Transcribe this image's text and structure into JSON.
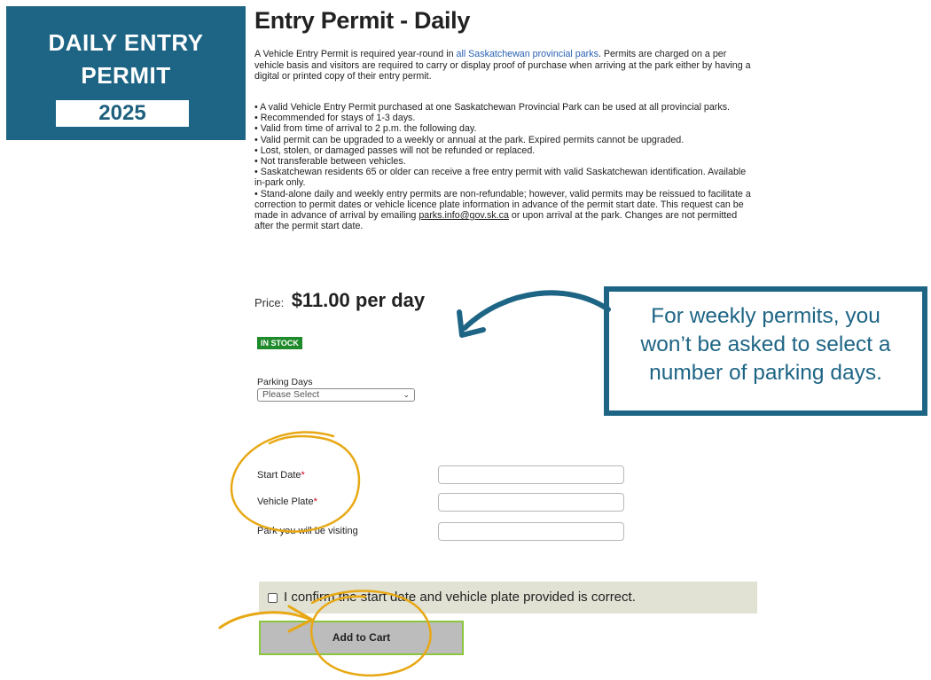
{
  "badge": {
    "line1": "DAILY ENTRY",
    "line2": "PERMIT",
    "year": "2025"
  },
  "page": {
    "title": "Entry Permit - Daily",
    "intro_before_link": "A Vehicle Entry Permit is required year-round in ",
    "intro_link": "all Saskatchewan provincial parks",
    "intro_after_link": ". Permits are charged on a per vehicle basis and visitors are required to carry or display proof of purchase when arriving at the park either by having a digital or printed copy of their entry permit."
  },
  "bullets": [
    "•  A valid Vehicle Entry Permit purchased at one Saskatchewan Provincial Park can be used at all provincial parks.",
    "•  Recommended for stays of 1-3 days.",
    "•  Valid from time of arrival to 2 p.m. the following day.",
    "•  Valid permit can be upgraded to a weekly or annual at the park. Expired permits cannot be upgraded.",
    "•  Lost, stolen, or damaged passes will not be refunded or replaced.",
    "•  Not transferable between vehicles.",
    "•  Saskatchewan residents 65 or older can receive a free entry permit with valid Saskatchewan identification. Available in-park only."
  ],
  "last_bullet": {
    "before_link": "•  Stand-alone daily and weekly entry permits are non-refundable; however, valid permits may be reissued to facilitate a correction to permit dates or vehicle licence plate information in advance of the permit start date. This request can be made in advance of arrival by emailing ",
    "link": "parks.info@gov.sk.ca",
    "after_link": " or upon arrival at the park. Changes are not permitted after the permit start date."
  },
  "price": {
    "label": "Price:",
    "value": "$11.00 per day"
  },
  "stock_badge": "IN STOCK",
  "parking": {
    "label": "Parking Days",
    "selected": "Please Select"
  },
  "fields": {
    "start_date_label": "Start Date",
    "vehicle_plate_label": "Vehicle Plate",
    "park_label": "Park you will be visiting",
    "required_mark": "*"
  },
  "confirm_text": "I confirm the start date and vehicle plate provided is correct.",
  "add_to_cart": "Add to Cart",
  "callout": {
    "line1": "For weekly permits, you",
    "line2": "won’t be asked to select a",
    "line3": "number of parking days."
  },
  "colors": {
    "brand_blue": "#1e6585",
    "annotation_gold": "#e8a814",
    "stock_green": "#1e8a2b",
    "button_border_green": "#8cc63f"
  }
}
